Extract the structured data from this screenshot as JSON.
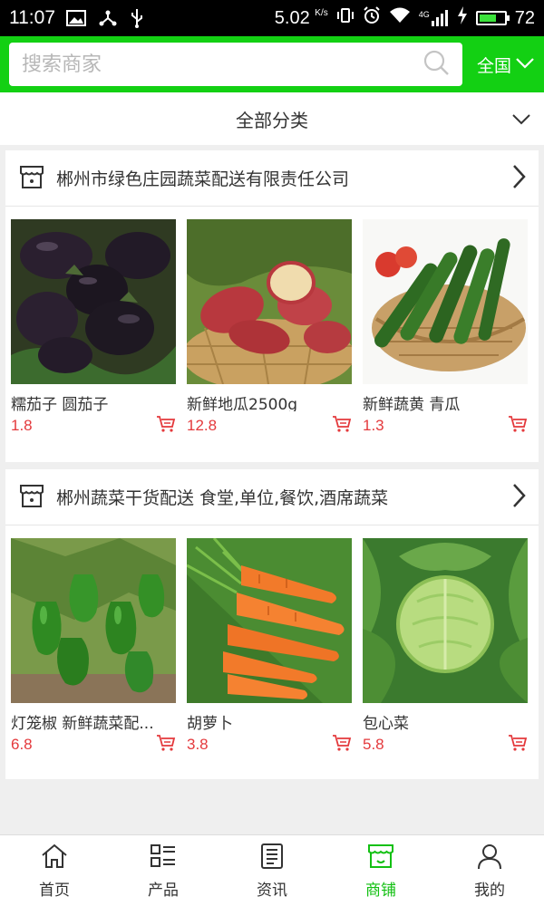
{
  "status_bar": {
    "time": "11:07",
    "speed": "5.02",
    "speed_unit": "K/s",
    "network": "4G",
    "battery": "72",
    "battery_level": 0.72
  },
  "header": {
    "search_placeholder": "搜索商家",
    "region": "全国",
    "accent_color": "#13d013"
  },
  "category": {
    "label": "全部分类"
  },
  "stores": [
    {
      "name": "郴州市绿色庄园蔬菜配送有限责任公司",
      "products": [
        {
          "name": "糯茄子 圆茄子",
          "price": "1.8",
          "image": "eggplant"
        },
        {
          "name": "新鲜地瓜2500g",
          "price": "12.8",
          "image": "sweet-potato"
        },
        {
          "name": "新鲜蔬黄 青瓜",
          "price": "1.3",
          "image": "cucumber"
        }
      ]
    },
    {
      "name": "郴州蔬菜干货配送 食堂,单位,餐饮,酒席蔬菜",
      "products": [
        {
          "name": "灯笼椒 新鲜蔬菜配...",
          "price": "6.8",
          "image": "bell-pepper"
        },
        {
          "name": "胡萝卜",
          "price": "3.8",
          "image": "carrot"
        },
        {
          "name": "包心菜",
          "price": "5.8",
          "image": "cabbage"
        }
      ]
    }
  ],
  "bottom_nav": {
    "items": [
      {
        "label": "首页",
        "icon": "home-icon"
      },
      {
        "label": "产品",
        "icon": "grid-list-icon"
      },
      {
        "label": "资讯",
        "icon": "news-icon"
      },
      {
        "label": "商铺",
        "icon": "store-icon",
        "active": true
      },
      {
        "label": "我的",
        "icon": "user-icon"
      }
    ],
    "active_color": "#13c013"
  },
  "price_color": "#e4393c"
}
